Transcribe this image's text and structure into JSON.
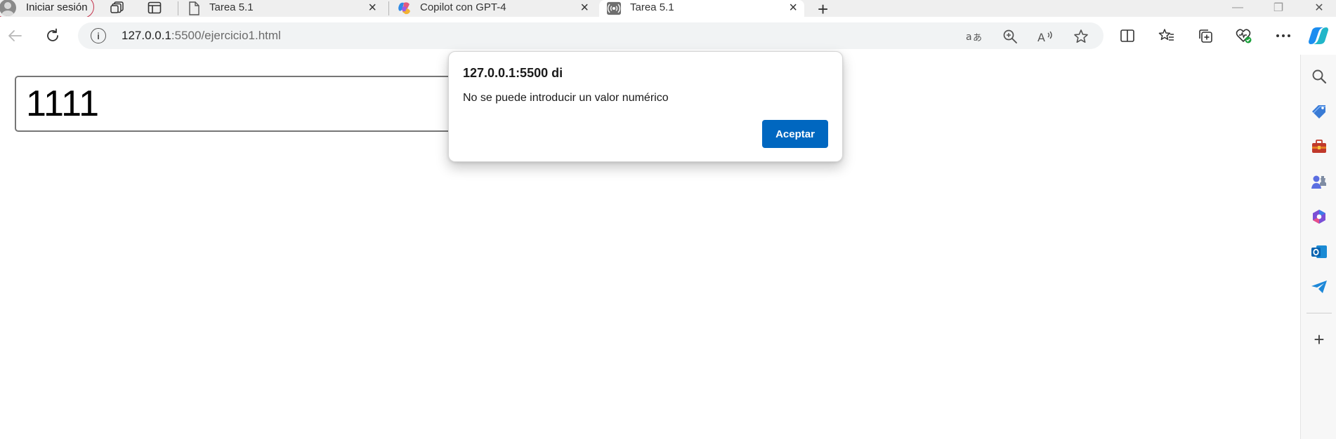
{
  "browser": {
    "profile_label": "Iniciar sesión",
    "tabs": [
      {
        "title": "Tarea 5.1",
        "favicon": "document-icon"
      },
      {
        "title": "Copilot con GPT-4",
        "favicon": "copilot-icon"
      },
      {
        "title": "Tarea 5.1",
        "favicon": "broadcast-icon",
        "active": true
      }
    ],
    "tab_close_glyph": "×",
    "new_tab_glyph": "+",
    "window_controls": {
      "minimize": "—",
      "restore": "❐",
      "close": "✕"
    },
    "address": {
      "host": "127.0.0.1",
      "path": ":5500/ejercicio1.html"
    },
    "sidebar_add_glyph": "+"
  },
  "page": {
    "input_value": "1111"
  },
  "dialog": {
    "title": "127.0.0.1:5500 di",
    "message": "No se puede introducir un valor numérico",
    "ok_label": "Aceptar"
  },
  "colors": {
    "accent": "#0067c0",
    "profile_border": "#c4314b"
  }
}
